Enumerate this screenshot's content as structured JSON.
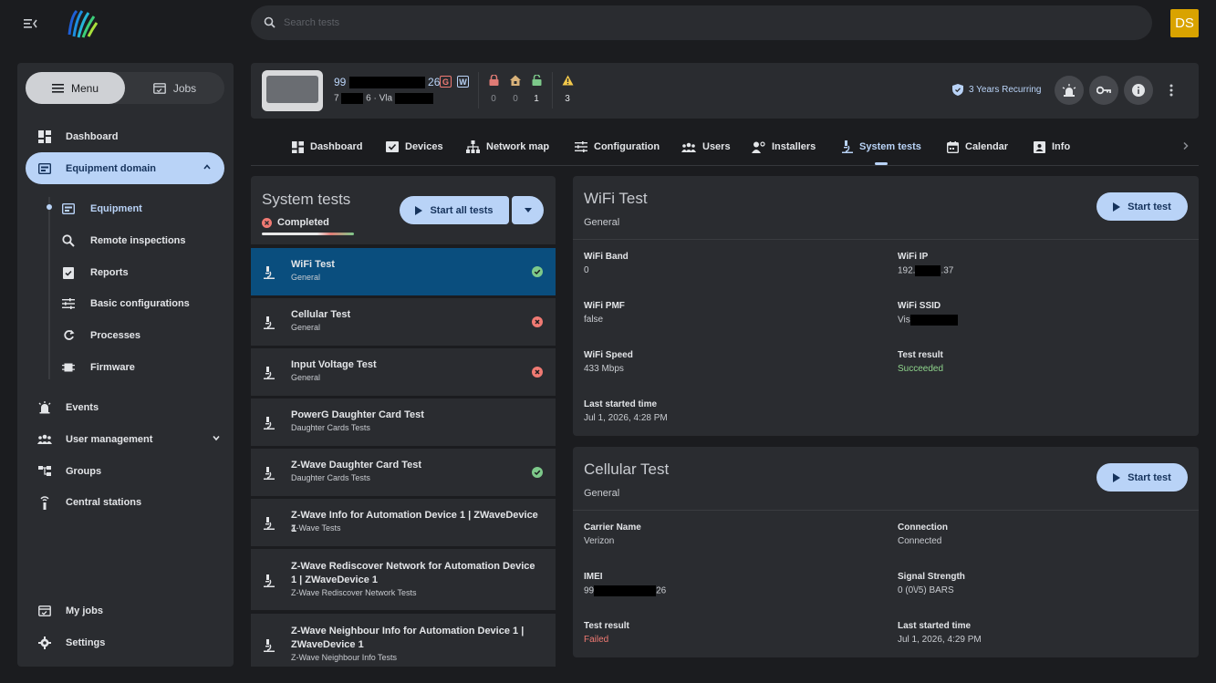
{
  "search": {
    "placeholder": "Search tests"
  },
  "user": {
    "initials": "DS"
  },
  "sidebar": {
    "segment": {
      "menu": "Menu",
      "jobs": "Jobs"
    },
    "items": [
      {
        "label": "Dashboard"
      },
      {
        "label": "Equipment domain"
      },
      {
        "label": "Equipment"
      },
      {
        "label": "Remote inspections"
      },
      {
        "label": "Reports"
      },
      {
        "label": "Basic configurations"
      },
      {
        "label": "Processes"
      },
      {
        "label": "Firmware"
      },
      {
        "label": "Events"
      },
      {
        "label": "User management"
      },
      {
        "label": "Groups"
      },
      {
        "label": "Central stations"
      },
      {
        "label": "My jobs"
      },
      {
        "label": "Settings"
      }
    ]
  },
  "device": {
    "id_prefix": "99",
    "id_suffix": "26",
    "line2_prefix": "7",
    "line2_mid": "6 · Vla",
    "badge_g": "G",
    "badge_w": "W",
    "stats": [
      {
        "value": "0"
      },
      {
        "value": "0"
      },
      {
        "value": "1"
      },
      {
        "value": "3"
      }
    ],
    "plan": "3 Years Recurring"
  },
  "tabs": [
    {
      "label": "Dashboard"
    },
    {
      "label": "Devices"
    },
    {
      "label": "Network map"
    },
    {
      "label": "Configuration"
    },
    {
      "label": "Users"
    },
    {
      "label": "Installers"
    },
    {
      "label": "System tests"
    },
    {
      "label": "Calendar"
    },
    {
      "label": "Info"
    }
  ],
  "tests_panel": {
    "title": "System tests",
    "status": "Completed",
    "start_all": "Start all tests",
    "progress_fraction": 0.6
  },
  "tests": [
    {
      "name": "WiFi Test",
      "category": "General",
      "result": "passed"
    },
    {
      "name": "Cellular Test",
      "category": "General",
      "result": "failed"
    },
    {
      "name": "Input Voltage Test",
      "category": "General",
      "result": "failed"
    },
    {
      "name": "PowerG Daughter Card Test",
      "category": "Daughter Cards Tests",
      "result": "none"
    },
    {
      "name": "Z-Wave Daughter Card Test",
      "category": "Daughter Cards Tests",
      "result": "passed"
    },
    {
      "name": "Z-Wave Info for Automation Device 1 | ZWaveDevice 1",
      "category": "Z-Wave Tests",
      "result": "none"
    },
    {
      "name": "Z-Wave Rediscover Network for Automation Device 1 | ZWaveDevice 1",
      "category": "Z-Wave Rediscover Network Tests",
      "result": "none"
    },
    {
      "name": "Z-Wave Neighbour Info for Automation Device 1 | ZWaveDevice 1",
      "category": "Z-Wave Neighbour Info Tests",
      "result": "none"
    }
  ],
  "wifi_card": {
    "title": "WiFi Test",
    "subtitle": "General",
    "button": "Start test",
    "fields": {
      "band": {
        "label": "WiFi Band",
        "value": "0"
      },
      "ip": {
        "label": "WiFi IP",
        "value_prefix": "192.",
        "value_suffix": ".37"
      },
      "pmf": {
        "label": "WiFi PMF",
        "value": "false"
      },
      "ssid": {
        "label": "WiFi SSID",
        "value_prefix": "Vis"
      },
      "speed": {
        "label": "WiFi Speed",
        "value": "433 Mbps"
      },
      "result": {
        "label": "Test result",
        "value": "Succeeded"
      },
      "last": {
        "label": "Last started time",
        "value": "Jul 1, 2026, 4:28 PM"
      }
    }
  },
  "cell_card": {
    "title": "Cellular Test",
    "subtitle": "General",
    "button": "Start test",
    "fields": {
      "carrier": {
        "label": "Carrier Name",
        "value": "Verizon"
      },
      "conn": {
        "label": "Connection",
        "value": "Connected"
      },
      "imei": {
        "label": "IMEI",
        "value_prefix": "99",
        "value_suffix": "26"
      },
      "signal": {
        "label": "Signal Strength",
        "value": "0 (0\\/5) BARS"
      },
      "result": {
        "label": "Test result",
        "value": "Failed"
      },
      "last": {
        "label": "Last started time",
        "value": "Jul 1, 2026, 4:29 PM"
      }
    }
  },
  "colors": {
    "accent": "#b9d3f7",
    "selected_row": "#0a4e7e",
    "success": "#8fd48c",
    "error": "#f07a73",
    "avatar": "#d9a300"
  }
}
